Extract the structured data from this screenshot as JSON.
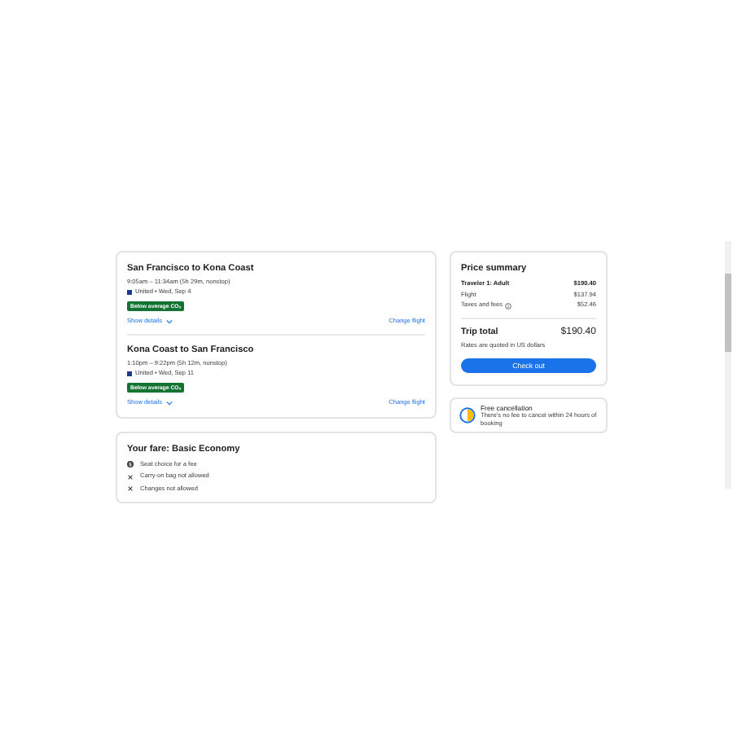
{
  "flights": [
    {
      "route": "San Francisco to Kona Coast",
      "times": "9:05am – 11:34am (5h 29m, nonstop)",
      "airline": "United • Wed, Sep 4",
      "badge": "Below average CO₂",
      "details": "Show details",
      "change": "Change flight"
    },
    {
      "route": "Kona Coast to San Francisco",
      "times": "1:10pm – 9:22pm (5h 12m, nonstop)",
      "airline": "United • Wed, Sep 11",
      "badge": "Below average CO₂",
      "details": "Show details",
      "change": "Change flight"
    }
  ],
  "fare": {
    "title": "Your fare: Basic Economy",
    "items": [
      {
        "kind": "paid",
        "text": "Seat choice for a fee"
      },
      {
        "kind": "no",
        "text": "Carry-on bag not allowed"
      },
      {
        "kind": "no",
        "text": "Changes not allowed"
      }
    ]
  },
  "price": {
    "title": "Price summary",
    "rows": [
      {
        "label": "Traveler 1: Adult",
        "value": "$190.40",
        "bold": true,
        "info": false
      },
      {
        "label": "Flight",
        "value": "$137.94",
        "bold": false,
        "info": false
      },
      {
        "label": "Taxes and fees",
        "value": "$52.46",
        "bold": false,
        "info": true
      }
    ],
    "total_label": "Trip total",
    "total": "$190.40",
    "note": "Rates are quoted in US dollars",
    "button": "Check out"
  },
  "cancellation": {
    "title": "Free cancellation",
    "text": "There's no fee to cancel within 24 hours of booking"
  }
}
